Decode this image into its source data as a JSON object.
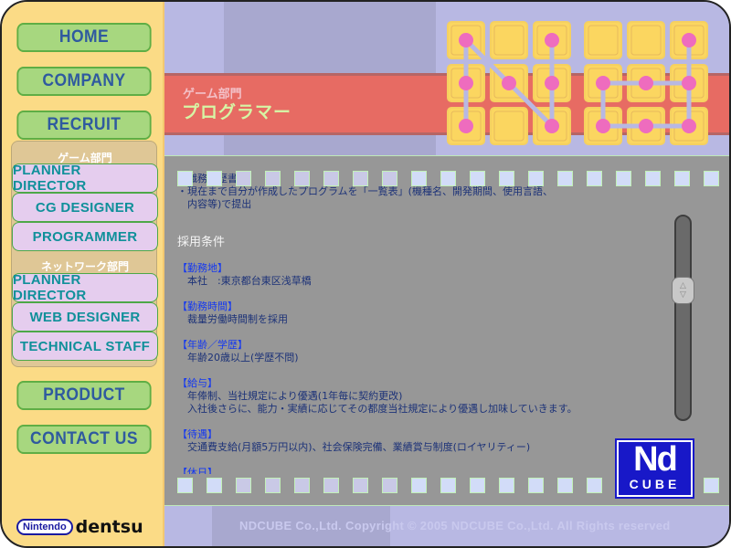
{
  "nav": {
    "home": "HOME",
    "company": "COMPANY",
    "recruit": "RECRUIT",
    "product": "PRODUCT",
    "contact": "CONTACT US"
  },
  "submenu": {
    "game_dept": "ゲーム部門",
    "game_items": [
      "PLANNER  DIRECTOR",
      "CG DESIGNER",
      "PROGRAMMER"
    ],
    "network_dept": "ネットワーク部門",
    "network_items": [
      "PLANNER  DIRECTOR",
      "WEB DESIGNER",
      "TECHNICAL STAFF"
    ]
  },
  "partners": {
    "nintendo": "Nintendo",
    "dentsu": "dentsu"
  },
  "header": {
    "department": "ゲーム部門",
    "title": "プログラマー",
    "logo_icon": "nd-dot-grid-logo"
  },
  "content": {
    "lines": [
      {
        "text": "・職務経歴書",
        "style": "normal"
      },
      {
        "text": "・現在まで自分が作成したプログラムを「一覧表」(機種名、開発期間、使用言語、",
        "style": "normal"
      },
      {
        "text": "　内容等)で提出",
        "style": "normal"
      },
      {
        "text": "",
        "style": "spacer"
      },
      {
        "text": "",
        "style": "spacer"
      },
      {
        "text": "採用条件",
        "style": "white"
      },
      {
        "text": "",
        "style": "spacer"
      },
      {
        "text": "【勤務地】",
        "style": "blue"
      },
      {
        "text": "　本社　:東京都台東区浅草橋",
        "style": "normal"
      },
      {
        "text": "",
        "style": "spacer"
      },
      {
        "text": "【勤務時間】",
        "style": "blue"
      },
      {
        "text": "　裁量労働時間制を採用",
        "style": "normal"
      },
      {
        "text": "",
        "style": "spacer"
      },
      {
        "text": "【年齢／学歴】",
        "style": "blue"
      },
      {
        "text": "　年齢20歳以上(学歴不問)",
        "style": "normal"
      },
      {
        "text": "",
        "style": "spacer"
      },
      {
        "text": "【給与】",
        "style": "blue"
      },
      {
        "text": "　年俸制、当社規定により優遇(1年毎に契約更改)",
        "style": "normal"
      },
      {
        "text": "　入社後さらに、能力・実績に応じてその都度当社規定により優遇し加味していきます。",
        "style": "normal"
      },
      {
        "text": "",
        "style": "spacer"
      },
      {
        "text": "【待遇】",
        "style": "blue"
      },
      {
        "text": "　交通費支給(月額5万円以内)、社会保険完備、業績賞与制度(ロイヤリティー)",
        "style": "normal"
      },
      {
        "text": "",
        "style": "spacer"
      },
      {
        "text": "【休日】",
        "style": "blue"
      }
    ],
    "scroll_position": 0.35
  },
  "ndcube_logo": {
    "top": "Nd",
    "bottom": "CUBE"
  },
  "footer": {
    "copyright": "NDCUBE Co.,Ltd. Copyright © 2005 NDCUBE Co.,Ltd. All Rights reserved"
  },
  "colors": {
    "sidebar_bg": "#fbdb86",
    "nav_button": "#a7d77f",
    "nav_text": "#2f5a9f",
    "sub_button": "#e5cdee",
    "sub_text": "#10909a",
    "header_band": "#e76b63",
    "content_bg": "#979797",
    "heading_blue": "#1438f0",
    "logo_blue": "#1818c8",
    "dot_pink": "#ee6cbe",
    "cell_yellow": "#fbd660"
  }
}
